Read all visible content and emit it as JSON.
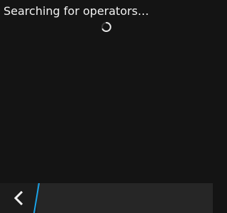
{
  "status": {
    "message": "Searching for operators…",
    "spinner_icon": "loading-spinner-icon"
  },
  "action_bar": {
    "back_icon": "chevron-left-icon"
  },
  "colors": {
    "background": "#141414",
    "text": "#f2f2f2",
    "action_bar": "#262626",
    "accent": "#1aa3e8"
  }
}
